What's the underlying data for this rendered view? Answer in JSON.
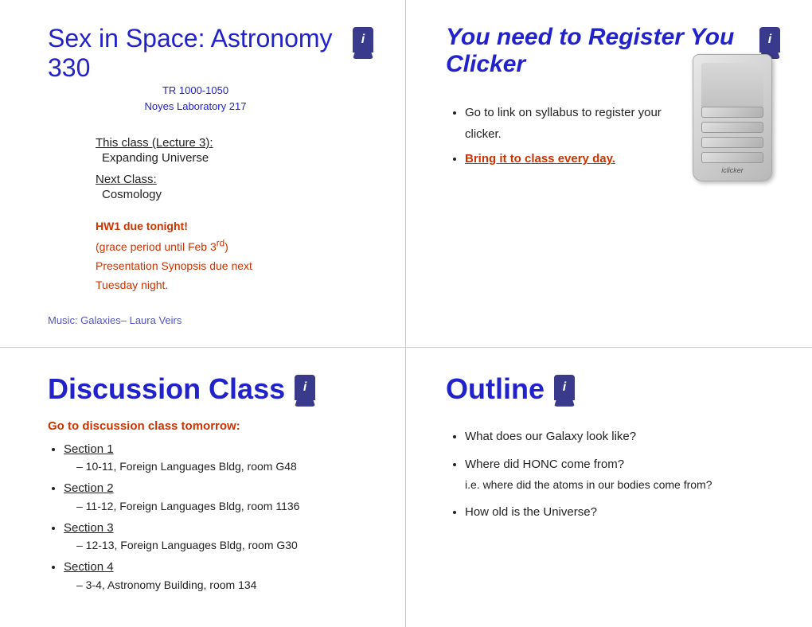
{
  "topLeft": {
    "courseTitle": "Sex in Space: Astronomy 330",
    "courseSub1": "TR 1000-1050",
    "courseSub2": "Noyes Laboratory 217",
    "lectureLabel": "This class (Lecture 3):",
    "lectureValue": "Expanding Universe",
    "nextLabel": "Next Class:",
    "nextValue": "Cosmology",
    "hwLine1": "HW1 due tonight!",
    "hwLine2": "(grace period until Feb 3",
    "hwSup": "rd",
    "hwLine3": ")",
    "hwLine4": "Presentation Synopsis due next",
    "hwLine5": "Tuesday night.",
    "musicLine": "Music: Galaxies– Laura Veirs"
  },
  "topRight": {
    "registerTitle": "You need to Register You Clicker",
    "bullet1": "Go to link on syllabus to register your clicker.",
    "bullet2": "Bring it to class every day.",
    "clickerLabel": "iclicker"
  },
  "bottomLeft": {
    "sectionTitle": "Discussion Class",
    "goDiscussion": "Go to discussion class tomorrow:",
    "sections": [
      {
        "name": "Section 1",
        "detail": "– 10-11, Foreign Languages Bldg, room G48"
      },
      {
        "name": "Section 2",
        "detail": "– 11-12, Foreign Languages Bldg, room 1136"
      },
      {
        "name": "Section 3",
        "detail": "– 12-13, Foreign Languages Bldg, room G30"
      },
      {
        "name": "Section 4",
        "detail": "– 3-4, Astronomy Building, room 134"
      }
    ]
  },
  "bottomRight": {
    "outlineTitle": "Outline",
    "items": [
      {
        "main": "What does our Galaxy look like?"
      },
      {
        "main": "Where did HONC come from?",
        "sub": "i.e. where did the atoms in our bodies come from?"
      },
      {
        "main": "How old is the Universe?"
      }
    ]
  }
}
